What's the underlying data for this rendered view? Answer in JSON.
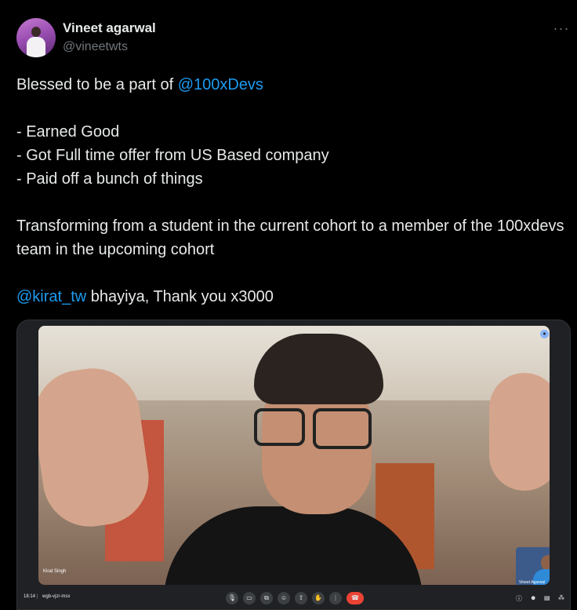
{
  "author": {
    "name": "Vineet agarwal",
    "handle": "@vineetwts"
  },
  "menu": {
    "more_icon": "more-horizontal-icon",
    "more_glyph": "···"
  },
  "tweet": {
    "line1_prefix": "Blessed to be a part of ",
    "line1_mention": "@100xDevs",
    "line2": "- Earned Good",
    "line3": "- Got Full time offer from US Based company",
    "line4": "- Paid off a bunch of things",
    "line5": "Transforming from a student in the current cohort to a member of the 100xdevs team in the upcoming cohort",
    "line6_mention": "@kirat_tw",
    "line6_suffix": " bhayiya, Thank you x3000"
  },
  "media": {
    "speaker_label": "Kirat Singh",
    "pip_name": "Vineet Agarwal",
    "meeting_time": "18:14",
    "meeting_separator": "|",
    "meeting_code": "wgb-vjzr-msx",
    "controls": [
      "mic-icon",
      "camera-icon",
      "captions-icon",
      "emoji-icon",
      "present-icon",
      "raise-hand-icon",
      "more-vert-icon",
      "end-call-icon"
    ],
    "right_controls": [
      "info-icon",
      "people-icon",
      "chat-icon",
      "activities-icon"
    ]
  },
  "colors": {
    "background": "#000000",
    "text": "#e7e9ea",
    "secondary": "#71767b",
    "link": "#1d9bf0",
    "end_call": "#ea4335"
  }
}
